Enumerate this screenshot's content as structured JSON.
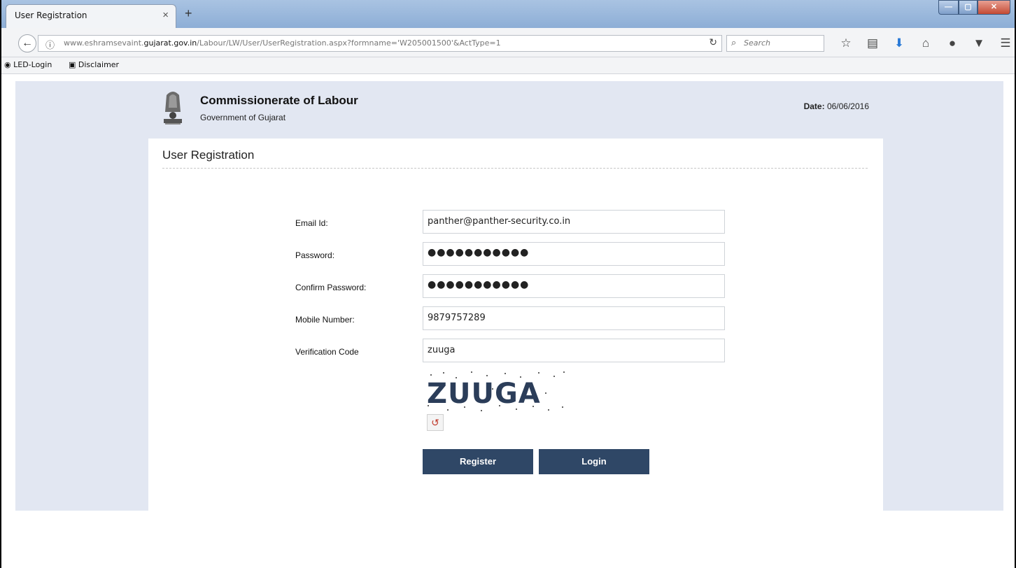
{
  "browser": {
    "tab_title": "User Registration",
    "tab_close": "×",
    "new_tab": "+",
    "url_prefix": "www.eshramsevaint.",
    "url_domain": "gujarat.gov.in",
    "url_path": "/Labour/LW/User/UserRegistration.aspx?formname='W205001500'&ActType=1",
    "search_placeholder": "Search",
    "bookmarks": [
      "LED-Login",
      "Disclaimer"
    ],
    "icons": [
      "back-arrow-icon",
      "info-icon",
      "reload-icon",
      "search-icon",
      "star-icon",
      "reading-list-icon",
      "download-icon",
      "home-icon",
      "chat-icon",
      "pocket-icon",
      "menu-icon"
    ]
  },
  "header": {
    "org_title": "Commissionerate of Labour",
    "org_subtitle": "Government of Gujarat",
    "date_label": "Date:",
    "date_value": "06/06/2016"
  },
  "form": {
    "title": "User Registration",
    "fields": [
      {
        "label": "Email Id:",
        "value": "panther@panther-security.co.in"
      },
      {
        "label": "Password:",
        "value": "●●●●●●●●●●●"
      },
      {
        "label": "Confirm Password:",
        "value": "●●●●●●●●●●●"
      },
      {
        "label": "Mobile Number:",
        "value": "9879757289"
      },
      {
        "label": "Verification Code",
        "value": "zuuga"
      }
    ],
    "captcha_text": "ZUUGA",
    "register_label": "Register",
    "login_label": "Login"
  },
  "colors": {
    "button_bg": "#2f4766",
    "page_bg": "#e2e7f2",
    "captcha_text": "#2b3d59"
  }
}
